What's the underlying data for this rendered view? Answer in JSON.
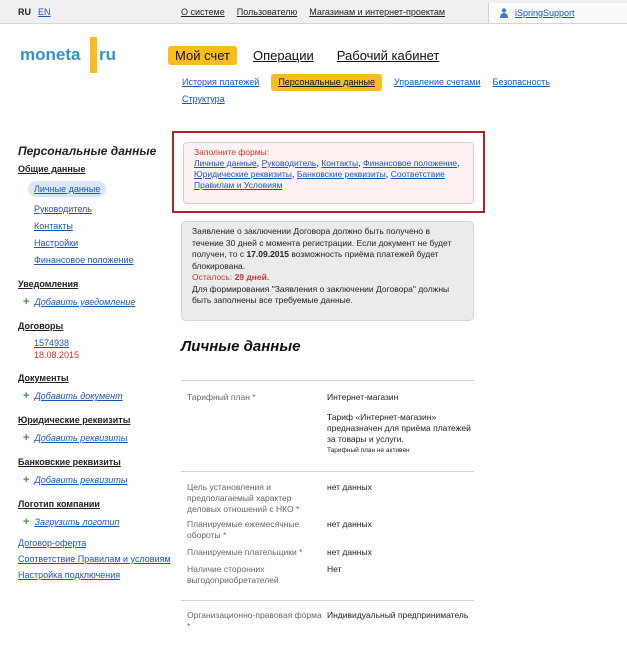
{
  "topbar": {
    "lang_ru": "RU",
    "lang_en": "EN",
    "links": [
      "О системе",
      "Пользователю",
      "Магазинам и интернет-проектам"
    ],
    "user": "iSpringSupport"
  },
  "logo": {
    "left": "moneta",
    "right": "ru"
  },
  "main_tabs": [
    "Мой счет",
    "Операции",
    "Рабочий кабинет"
  ],
  "subnav": [
    "История платежей",
    "Персональные данные",
    "Управление счетами",
    "Безопасность",
    "Структура"
  ],
  "sidebar": {
    "title": "Персональные данные",
    "general": "Общие данные",
    "general_items": [
      "Личные данные",
      "Руководитель",
      "Контакты",
      "Настройки",
      "Финансовое положение"
    ],
    "notifications": "Уведомления",
    "add_notification": "Добавить уведомление",
    "contracts": "Договоры",
    "contract_number": "1574938",
    "contract_date": "18.08.2015",
    "documents": "Документы",
    "add_document": "Добавить документ",
    "legal": "Юридические реквизиты",
    "add_legal": "Добавить реквизиты",
    "bank": "Банковские реквизиты",
    "add_bank": "Добавить реквизиты",
    "company_logo": "Логотип компании",
    "upload_logo": "Загрузить логотип",
    "bottom_links": [
      "Договор-оферта",
      "Соответствие Правилам и условиям",
      "Настройка подключения"
    ]
  },
  "alert": {
    "header": "Заполните формы:",
    "links": [
      "Личные данные",
      "Руководитель",
      "Контакты",
      "Финансовое положение",
      "Юридические реквизиты",
      "Банковские реквизиты",
      "Соответствие Правилам и Условиям"
    ]
  },
  "notice": {
    "line1a": "Заявление о заключении Договора должно быть получено в течение 30 дней с момента регистрации. Если документ не будет получен, то с ",
    "date": "17.09.2015",
    "line1b": " возможность приёма платежей будет блокирована.",
    "remaining_label": "Осталось: ",
    "remaining_value": "29 дней.",
    "line2": "Для формирования \"Заявления о заключении Договора\" должны быть заполнены все требуемые данные."
  },
  "section_title": "Личные данные",
  "form": {
    "tariff_label": "Тарифный план *",
    "tariff_value": "Интернет-магазин",
    "tariff_desc": "Тариф «Интернет-магазин» предназначен для приёма платежей за товары и услуги.",
    "tariff_note": "Тарифный план не активен",
    "purpose_label": "Цель установления и предполагаемый характер деловых отношений с НКО *",
    "purpose_value": "нет данных",
    "turnover_label": "Планируемые ежемесячные обороты *",
    "turnover_value": "нет данных",
    "payers_label": "Планируемые плательщики *",
    "payers_value": "нет данных",
    "beneficiaries_label": "Наличие сторонних выгодоприобретателей",
    "beneficiaries_value": "Нет",
    "legal_form_label": "Организационно-правовая форма *",
    "legal_form_value": "Индивидуальный предприниматель"
  },
  "colors": {
    "accent": "#f8bd1d",
    "link": "#1a56b8",
    "alert_border": "#b3232a",
    "logo_blue": "#3393c9"
  }
}
